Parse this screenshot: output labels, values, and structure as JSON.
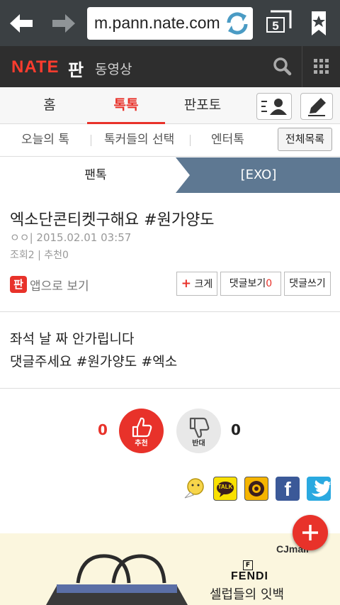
{
  "browser": {
    "url": "m.pann.nate.com",
    "tab_count": "5"
  },
  "header": {
    "logo": "NATE",
    "logo_sub": "판",
    "video_link": "동영상"
  },
  "main_tabs": [
    {
      "label": "홈"
    },
    {
      "label": "톡톡",
      "active": true
    },
    {
      "label": "판포토"
    }
  ],
  "sub_tabs": [
    {
      "label": "오늘의 톡"
    },
    {
      "label": "톡커들의 선택"
    },
    {
      "label": "엔터톡"
    }
  ],
  "all_list_label": "전체목록",
  "breadcrumb": {
    "parent": "팬톡",
    "current": "[EXO]"
  },
  "post": {
    "title": "엑소단콘티켓구해요 #원가양도",
    "author_date": "ㅇㅇ| 2015.02.01 03:57",
    "stats": "조회2 | 추천0",
    "app_icon": "판",
    "app_view": "앱으로 보기",
    "btn_bigger": "크게",
    "btn_bigger_plus": "+",
    "btn_view_comments": "댓글보기",
    "comment_count": "0",
    "btn_write_comment": "댓글쓰기",
    "body_line1": "좌석 날 짜 안가립니다",
    "body_line2": "댓글주세요 #원가양도 #엑소"
  },
  "votes": {
    "up_count": "0",
    "up_label": "추천",
    "down_count": "0",
    "down_label": "반대"
  },
  "share": {
    "facebook_glyph": "f",
    "kakaotalk_label": "TALK"
  },
  "ad": {
    "brand": "CJmall",
    "fendi": "FENDI",
    "fendi_icon": "F",
    "copy": "셀럽들의 잇백"
  },
  "colors": {
    "accent": "#e8322a",
    "browser_bar": "#3b4043",
    "header_bg": "#2e2e2e",
    "breadcrumb_bg": "#5e7892",
    "facebook": "#3b5998",
    "twitter": "#2aa9e0"
  },
  "icons": [
    "back-arrow-icon",
    "forward-arrow-icon",
    "refresh-icon",
    "tabs-icon",
    "bookmark-icon",
    "search-icon",
    "grid-menu-icon",
    "profile-list-icon",
    "pencil-icon",
    "thumbs-up-icon",
    "thumbs-down-icon",
    "plus-icon"
  ]
}
